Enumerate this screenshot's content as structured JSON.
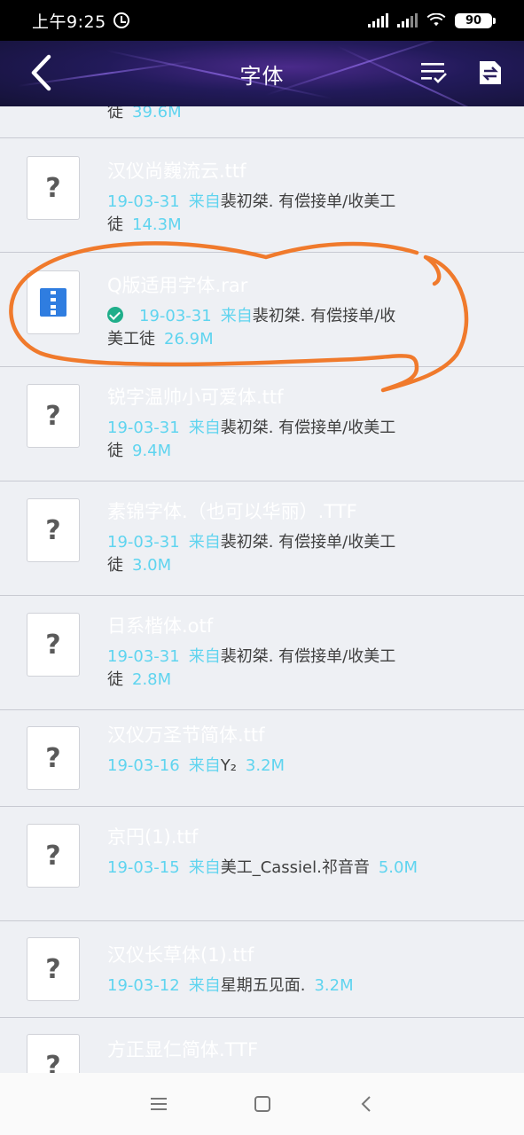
{
  "status_bar": {
    "time": "上午9:25",
    "battery": "90"
  },
  "header": {
    "title": "字体"
  },
  "files": [
    {
      "name": "",
      "date": "",
      "from_label": "",
      "sender": "",
      "tail_sender": "徒",
      "size": "39.6M",
      "icon": "question-mark"
    },
    {
      "name": "汉仪尚巍流云.ttf",
      "date": "19-03-31",
      "from_label": "来自",
      "sender": "裴初桀. 有偿接单/收美工",
      "tail_sender": "徒",
      "size": "14.3M",
      "icon": "question-mark"
    },
    {
      "name": "Q版适用字体.rar",
      "date": "19-03-31",
      "from_label": "来自",
      "sender": "裴初桀. 有偿接单/收",
      "tail_sender": "美工徒",
      "size": "26.9M",
      "icon": "zip-archive",
      "downloaded": true
    },
    {
      "name": "锐字温帅小可爱体.ttf",
      "date": "19-03-31",
      "from_label": "来自",
      "sender": "裴初桀. 有偿接单/收美工",
      "tail_sender": "徒",
      "size": "9.4M",
      "icon": "question-mark"
    },
    {
      "name": "素锦字体.（也可以华丽）.TTF",
      "date": "19-03-31",
      "from_label": "来自",
      "sender": "裴初桀. 有偿接单/收美工",
      "tail_sender": "徒",
      "size": "3.0M",
      "icon": "question-mark"
    },
    {
      "name": "日系楷体.otf",
      "date": "19-03-31",
      "from_label": "来自",
      "sender": "裴初桀. 有偿接单/收美工",
      "tail_sender": "徒",
      "size": "2.8M",
      "icon": "question-mark"
    },
    {
      "name": "汉仪万圣节简体.ttf",
      "date": "19-03-16",
      "from_label": "来自",
      "sender": "Y₂",
      "tail_sender": "",
      "size": "3.2M",
      "icon": "question-mark"
    },
    {
      "name": "京円(1).ttf",
      "date": "19-03-15",
      "from_label": "来自",
      "sender": "美工_Cassiel.祁音音",
      "tail_sender": "",
      "size": "5.0M",
      "icon": "question-mark"
    },
    {
      "name": "汉仪长草体(1).ttf",
      "date": "19-03-12",
      "from_label": "来自",
      "sender": "星期五见面.",
      "tail_sender": "",
      "size": "3.2M",
      "icon": "question-mark"
    },
    {
      "name": "方正显仁简体.TTF",
      "date": "",
      "from_label": "",
      "sender": "",
      "tail_sender": "",
      "size": "",
      "icon": "question-mark"
    }
  ],
  "colors": {
    "accent": "#5fd4ef",
    "annotation": "#f07a2c",
    "check": "#1fae8a",
    "zip": "#2f7de0"
  }
}
